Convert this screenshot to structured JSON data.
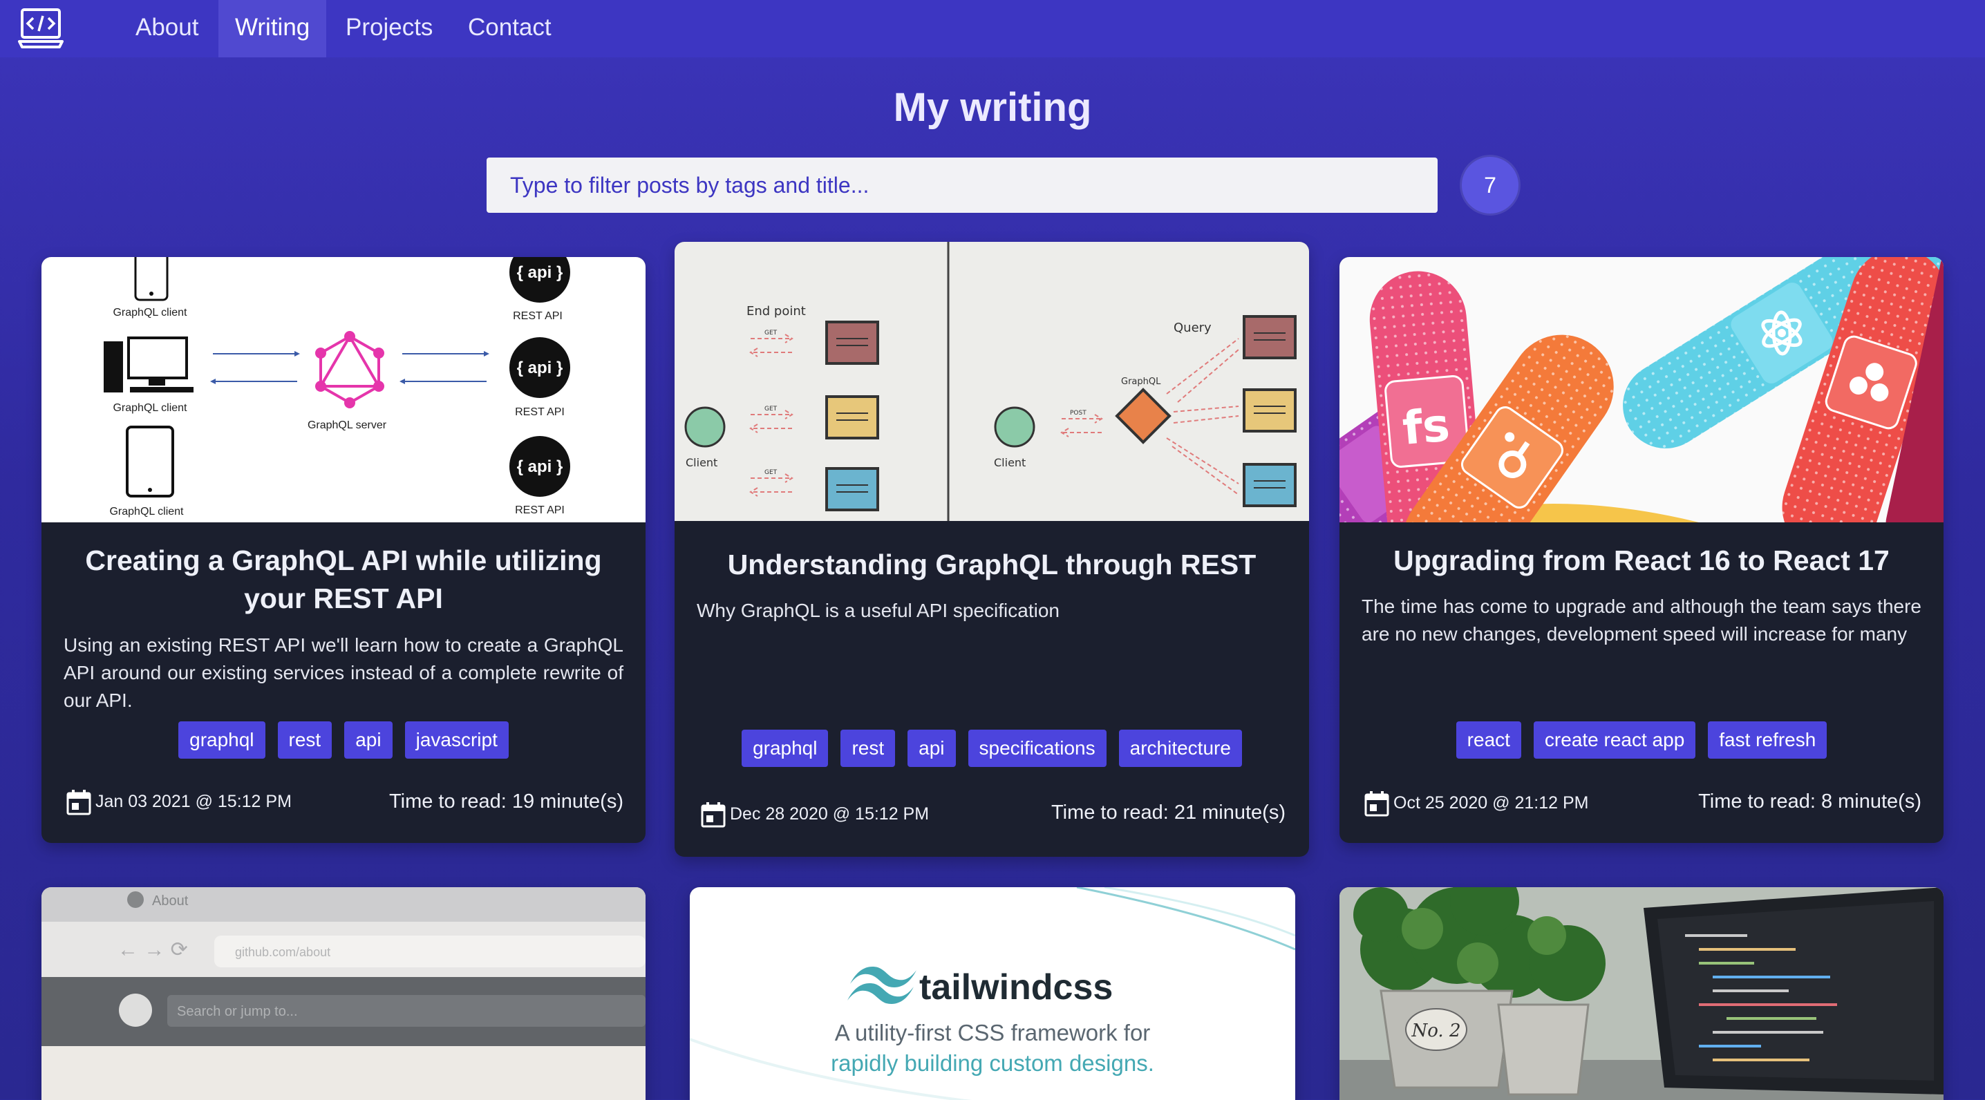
{
  "nav": {
    "logo_icon": "code-laptop-icon",
    "links": [
      {
        "label": "About"
      },
      {
        "label": "Writing"
      },
      {
        "label": "Projects"
      },
      {
        "label": "Contact"
      }
    ],
    "active": "Writing"
  },
  "header": {
    "title": "My writing",
    "search_placeholder": "Type to filter posts by tags and title...",
    "post_count": "7"
  },
  "posts": [
    {
      "title": "Creating a GraphQL API while utilizing your REST API",
      "description": "Using an existing REST API we'll learn how to create a GraphQL API around our existing services instead of a complete rewrite of our API.",
      "tags": [
        "graphql",
        "rest",
        "api",
        "javascript"
      ],
      "date": "Jan 03 2021 @ 15:12 PM",
      "read_time": "Time to read: 19 minute(s)",
      "image": {
        "client_label": "GraphQL client",
        "server_label": "GraphQL server",
        "api_label": "{ api }",
        "rest_label": "REST API"
      }
    },
    {
      "title": "Understanding GraphQL through REST",
      "description": "Why GraphQL is a useful API specification",
      "tags": [
        "graphql",
        "rest",
        "api",
        "specifications",
        "architecture"
      ],
      "date": "Dec 28 2020 @ 15:12 PM",
      "read_time": "Time to read: 21 minute(s)",
      "image": {
        "endpoint_label": "End point",
        "get_label": "GET",
        "client_label": "Client",
        "query_label": "Query",
        "graphql_label": "GraphQL",
        "post_label": "POST"
      }
    },
    {
      "title": "Upgrading from React 16 to React 17",
      "description": "The time has come to upgrade and although the team says there are no new changes, development speed will increase for many",
      "tags": [
        "react",
        "create react app",
        "fast refresh"
      ],
      "date": "Oct 25 2020 @ 21:12 PM",
      "read_time": "Time to read: 8 minute(s)",
      "image": {
        "fs_label": "fs"
      }
    },
    {
      "image": {
        "about_label": "About",
        "url_label": "github.com/about",
        "search_label": "Search or jump to..."
      }
    },
    {
      "image": {
        "brand": "tailwindcss",
        "tagline_1": "A utility-first CSS framework for",
        "tagline_2": "rapidly building custom designs."
      }
    },
    {
      "image": {
        "pot_label": "No. 2"
      }
    }
  ],
  "colors": {
    "nav_bg": "#3d36c2",
    "page_bg": "#302b9f",
    "card_bg": "#1b1f2e",
    "tag_bg": "#4c44dd",
    "tailwind_teal": "#44a8b3"
  }
}
